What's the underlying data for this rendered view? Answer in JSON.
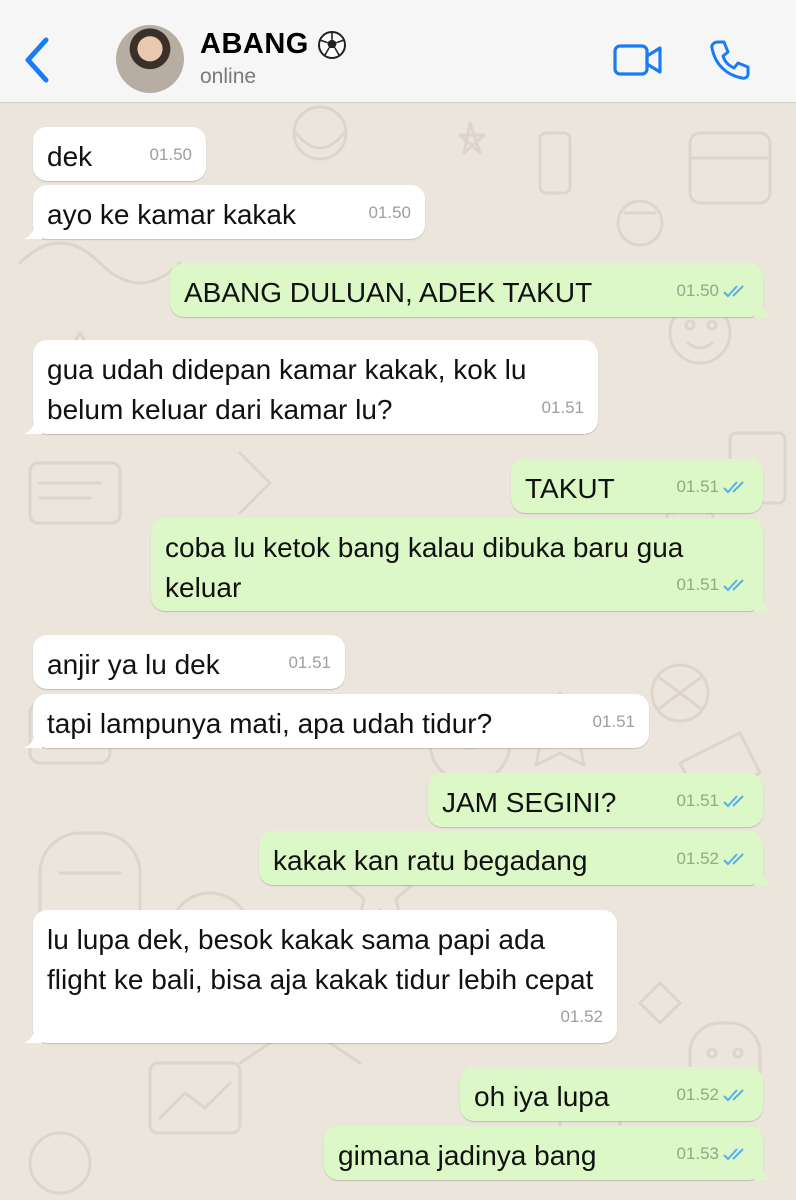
{
  "header": {
    "contact_name": "ABANG",
    "status": "online",
    "name_emoji_icon": "soccer-ball-icon",
    "accent_color": "#1a7cf5"
  },
  "messages": [
    {
      "dir": "in",
      "text": "dek",
      "time": "01.50"
    },
    {
      "dir": "in",
      "text": "ayo ke kamar kakak",
      "time": "01.50"
    },
    {
      "dir": "out",
      "text": "ABANG DULUAN, ADEK TAKUT",
      "time": "01.50",
      "read": true
    },
    {
      "dir": "in",
      "text": "gua udah didepan kamar kakak, kok lu belum keluar dari kamar lu?",
      "time": "01.51"
    },
    {
      "dir": "out",
      "text": "TAKUT",
      "time": "01.51",
      "read": true
    },
    {
      "dir": "out",
      "text": "coba lu ketok bang kalau dibuka baru gua keluar",
      "time": "01.51",
      "read": true
    },
    {
      "dir": "in",
      "text": "anjir ya lu dek",
      "time": "01.51"
    },
    {
      "dir": "in",
      "text": "tapi lampunya mati, apa udah tidur?",
      "time": "01.51"
    },
    {
      "dir": "out",
      "text": "JAM SEGINI?",
      "time": "01.51",
      "read": true
    },
    {
      "dir": "out",
      "text": "kakak kan ratu begadang",
      "time": "01.52",
      "read": true
    },
    {
      "dir": "in",
      "text": "lu lupa dek, besok kakak sama papi ada flight ke bali, bisa aja kakak tidur lebih cepat",
      "time": "01.52"
    },
    {
      "dir": "out",
      "text": "oh iya lupa",
      "time": "01.52",
      "read": true
    },
    {
      "dir": "out",
      "text": "gimana jadinya bang",
      "time": "01.53",
      "read": true
    }
  ]
}
